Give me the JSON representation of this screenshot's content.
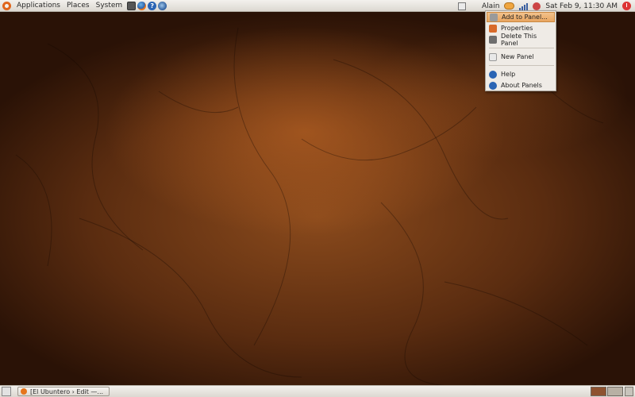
{
  "top_panel": {
    "menus": {
      "applications": "Applications",
      "places": "Places",
      "system": "System"
    },
    "user": "Alain",
    "clock": "Sat Feb  9, 11:30 AM"
  },
  "context_menu": {
    "items": [
      {
        "label": "Add to Panel...",
        "icon": "add-icon",
        "highlighted": true
      },
      {
        "label": "Properties",
        "icon": "properties-icon"
      },
      {
        "label": "Delete This Panel",
        "icon": "delete-icon"
      },
      {
        "label": "New Panel",
        "icon": "new-panel-icon"
      },
      {
        "label": "Help",
        "icon": "help-icon"
      },
      {
        "label": "About Panels",
        "icon": "about-icon"
      }
    ]
  },
  "bottom_panel": {
    "task": "[El Ubuntero › Edit —..."
  },
  "colors": {
    "accent": "#e9a560",
    "panel": "#dcd8d1",
    "wallpaper": "#8a4a1c"
  }
}
